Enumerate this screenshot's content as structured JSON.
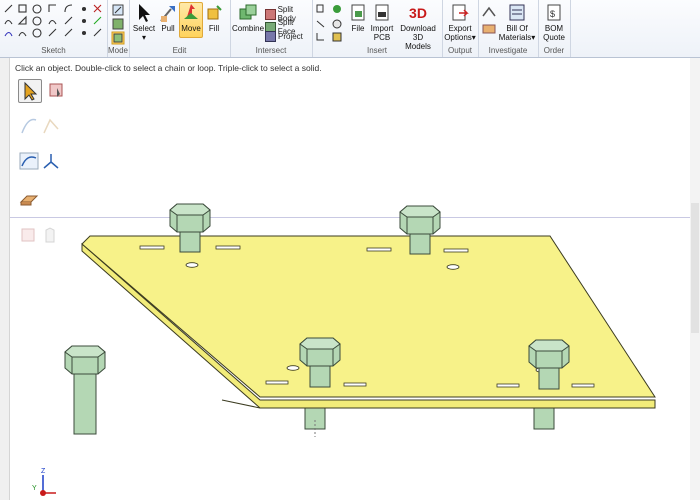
{
  "ribbon": {
    "groups": [
      {
        "id": "sketch",
        "label": "Sketch"
      },
      {
        "id": "mode",
        "label": "Mode"
      },
      {
        "id": "edit",
        "label": "Edit"
      },
      {
        "id": "intersect",
        "label": "Intersect"
      },
      {
        "id": "insert",
        "label": "Insert"
      },
      {
        "id": "output",
        "label": "Output"
      },
      {
        "id": "investigate",
        "label": "Investigate"
      },
      {
        "id": "order",
        "label": "Order"
      }
    ],
    "edit": {
      "select": "Select",
      "pull": "Pull",
      "move": "Move",
      "fill": "Fill"
    },
    "intersect": {
      "combine": "Combine",
      "split_body": "Split Body",
      "split_face": "Split Face",
      "project": "Project"
    },
    "insert": {
      "file": "File",
      "import_pcb_1": "Import",
      "import_pcb_2": "PCB",
      "download_1": "Download 3D",
      "download_2": "Models",
      "badge_3d": "3D"
    },
    "output": {
      "export_1": "Export",
      "export_2": "Options"
    },
    "investigate": {
      "bom_1": "Bill Of",
      "bom_2": "Materials"
    },
    "order": {
      "quote_1": "BOM",
      "quote_2": "Quote"
    }
  },
  "viewport": {
    "hint": "Click an object.  Double-click to select a chain or loop.  Triple-click to select a solid."
  },
  "triad": {
    "z": "Z",
    "y": "Y"
  },
  "colors": {
    "plate": "#f7f289",
    "bolt": "#b4d7b4",
    "active_tool": "#ffd35c"
  }
}
